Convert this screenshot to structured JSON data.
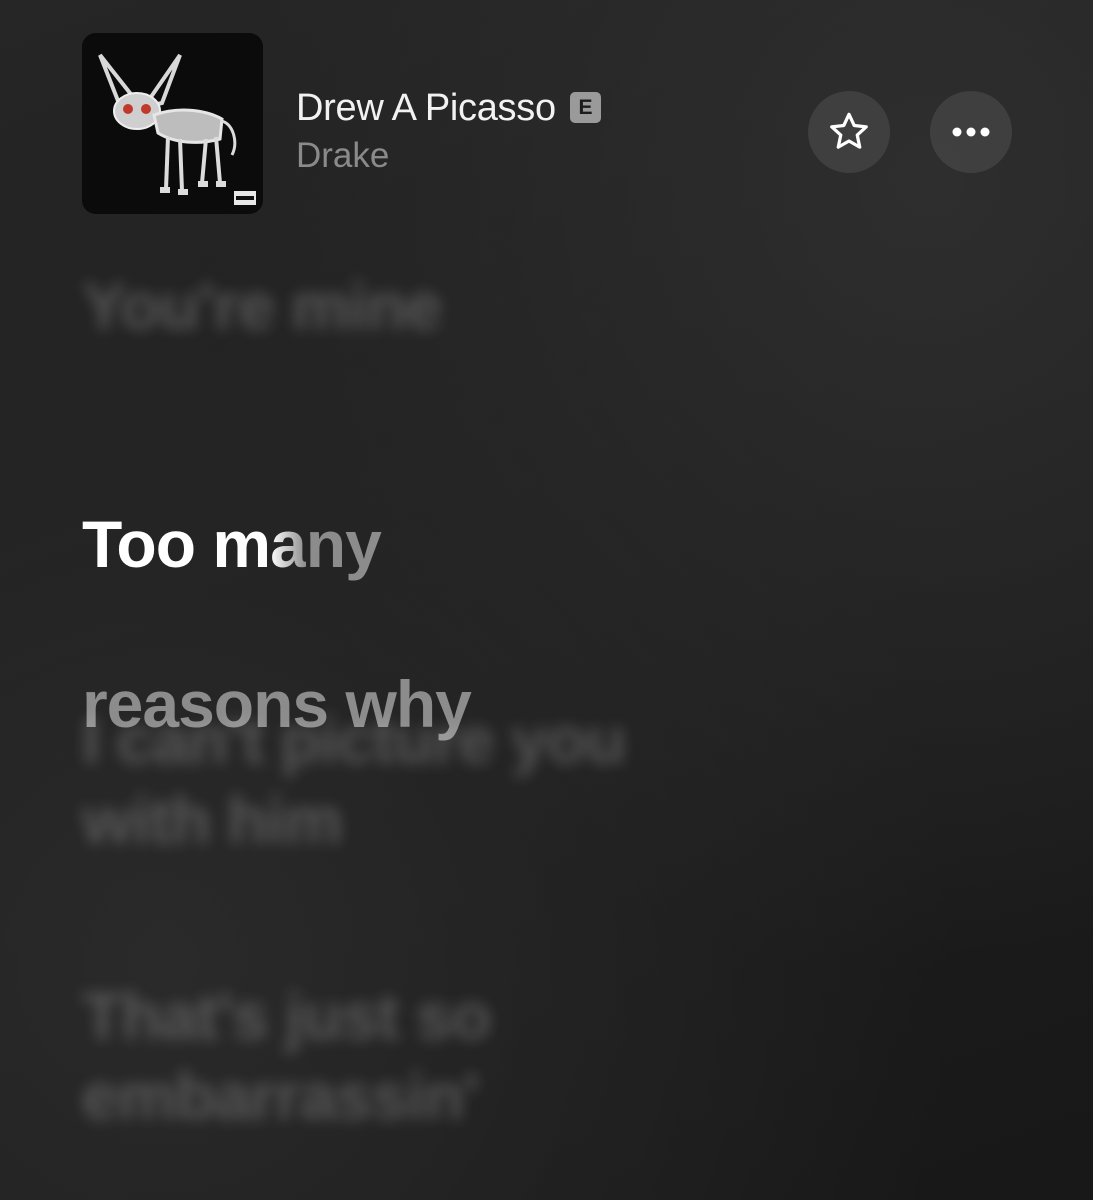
{
  "now_playing": {
    "title": "Drew A Picasso",
    "explicit_badge": "E",
    "artist": "Drake",
    "album_art_icon": "album-cover-drawing",
    "actions": {
      "favorite_icon": "star-icon",
      "more_icon": "ellipsis-icon"
    }
  },
  "lyrics": {
    "previous_line": "You're mine",
    "active": {
      "line1_sung": "Too m",
      "line1_transition": "a",
      "line1_unsung": "ny",
      "line2": "reasons why"
    },
    "upcoming": [
      "I can't picture you\nwith him",
      "That's just so\nembarrassin'"
    ]
  },
  "colors": {
    "background": "#1e1e1e",
    "active_text": "#ffffff",
    "pending_text": "#8c8c8c",
    "artist_text": "#8a8a8a"
  }
}
